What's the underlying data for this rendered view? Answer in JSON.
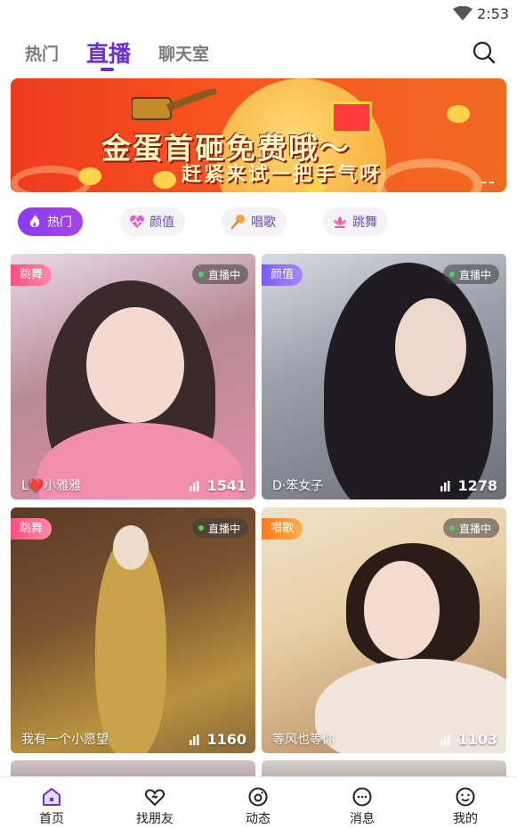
{
  "status_bar": {
    "time": "2:53",
    "icons": [
      "wifi-icon"
    ]
  },
  "top_tabs": {
    "items": [
      {
        "label": "热门",
        "active": false
      },
      {
        "label": "直播",
        "active": true
      },
      {
        "label": "聊天室",
        "active": false
      }
    ],
    "search_icon": "search-icon",
    "accent_color": "#6b2fd6"
  },
  "banner": {
    "title": "金蛋首砸免费哦～",
    "subtitle": "赶紧来试一把手气呀"
  },
  "categories": [
    {
      "label": "热门",
      "icon": "flame-icon",
      "active": true
    },
    {
      "label": "颜值",
      "icon": "heart-pulse-icon",
      "active": false
    },
    {
      "label": "唱歌",
      "icon": "microphone-icon",
      "active": false
    },
    {
      "label": "跳舞",
      "icon": "lotus-icon",
      "active": false
    }
  ],
  "live_cards": [
    {
      "tag": "跳舞",
      "status": "直播中",
      "name": "L❤️小雅雅",
      "views": "1541"
    },
    {
      "tag": "颜值",
      "status": "直播中",
      "name": "D·笨女子",
      "views": "1278"
    },
    {
      "tag": "跳舞",
      "status": "直播中",
      "name": "我有一个小愿望",
      "views": "1160"
    },
    {
      "tag": "唱歌",
      "status": "直播中",
      "name": "等风也等你",
      "views": "1103"
    }
  ],
  "bottom_nav": [
    {
      "label": "首页",
      "icon": "home-icon",
      "active": true
    },
    {
      "label": "找朋友",
      "icon": "heart-icon",
      "active": false
    },
    {
      "label": "动态",
      "icon": "moments-icon",
      "active": false
    },
    {
      "label": "消息",
      "icon": "message-icon",
      "active": false
    },
    {
      "label": "我的",
      "icon": "smile-icon",
      "active": false
    }
  ]
}
